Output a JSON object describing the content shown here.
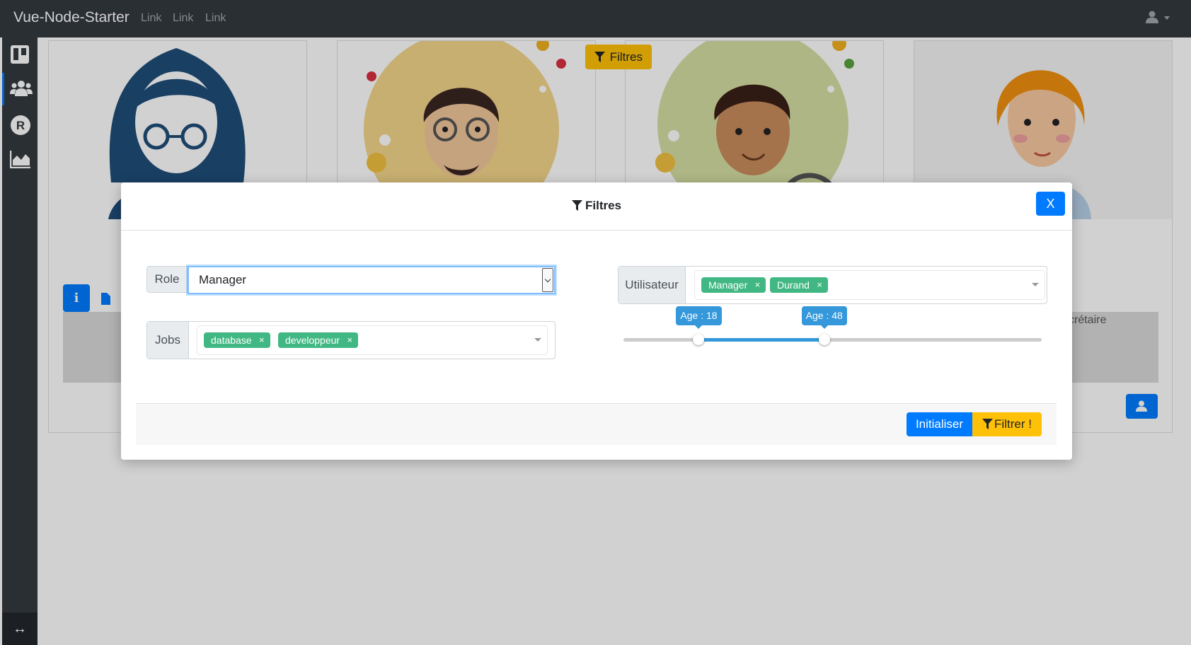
{
  "navbar": {
    "brand": "Vue-Node-Starter",
    "links": [
      "Link",
      "Link",
      "Link"
    ],
    "user_icon": "user-icon"
  },
  "sidebar": {
    "items": [
      {
        "icon": "trello-board-icon",
        "active": false
      },
      {
        "icon": "users-icon",
        "active": true
      },
      {
        "icon": "r-circle-icon",
        "active": false
      },
      {
        "icon": "area-chart-icon",
        "active": false
      }
    ],
    "footer_icon": "↔"
  },
  "background": {
    "filter_button_label": "Filtres",
    "info_button_label": "i",
    "partial_text": "crétaire"
  },
  "modal": {
    "title": "Filtres",
    "close_label": "X",
    "role": {
      "label": "Role",
      "value": "Manager"
    },
    "jobs": {
      "label": "Jobs",
      "tags": [
        "database",
        "developpeur"
      ]
    },
    "utilisateur": {
      "label": "Utilisateur",
      "tags": [
        "Manager",
        "Durand"
      ]
    },
    "age_slider": {
      "min_label": "Age : 18",
      "max_label": "Age : 48",
      "min_value": 18,
      "max_value": 48,
      "range_min": 0,
      "range_max": 100,
      "color": "#3498db"
    },
    "tag_remove_symbol": "×",
    "footer": {
      "reset_label": "Initialiser",
      "filter_label": "Filtrer !"
    }
  },
  "colors": {
    "primary": "#007bff",
    "warning": "#ffc107",
    "tag_green": "#41b883",
    "navbar": "#343a40"
  }
}
